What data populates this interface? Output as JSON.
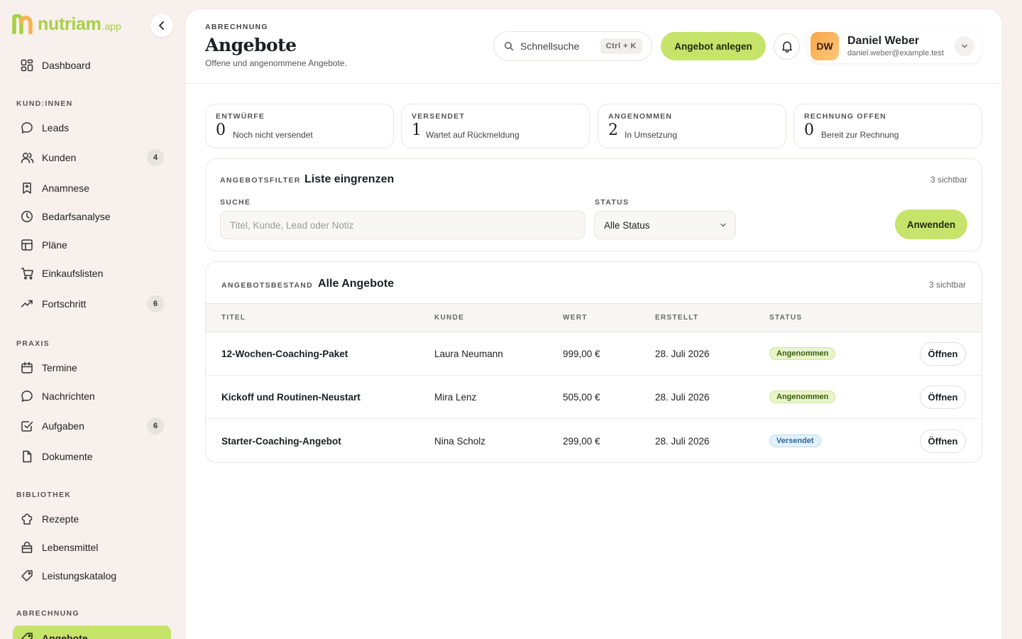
{
  "brand": {
    "name": "nutriam",
    "suffix": ".app"
  },
  "sidebar": {
    "sections": [
      "KUND:INNEN",
      "PRAXIS",
      "BIBLIOTHEK",
      "ABRECHNUNG"
    ],
    "items": [
      {
        "label": "Dashboard"
      },
      {
        "label": "Leads"
      },
      {
        "label": "Kunden",
        "badge": "4"
      },
      {
        "label": "Anamnese"
      },
      {
        "label": "Bedarfsanalyse"
      },
      {
        "label": "Pläne"
      },
      {
        "label": "Einkaufslisten"
      },
      {
        "label": "Fortschritt",
        "badge": "6"
      },
      {
        "label": "Termine"
      },
      {
        "label": "Nachrichten"
      },
      {
        "label": "Aufgaben",
        "badge": "6"
      },
      {
        "label": "Dokumente"
      },
      {
        "label": "Rezepte"
      },
      {
        "label": "Lebensmittel"
      },
      {
        "label": "Leistungskatalog"
      },
      {
        "label": "Angebote",
        "active": true
      }
    ]
  },
  "header": {
    "eyebrow": "ABRECHNUNG",
    "title": "Angebote",
    "subtitle": "Offene und angenommene Angebote.",
    "search_placeholder": "Schnellsuche",
    "shortcut": "Ctrl + K",
    "primary_action": "Angebot anlegen",
    "user": {
      "initials": "DW",
      "name": "Daniel Weber",
      "email": "daniel.weber@example.test"
    }
  },
  "stats": [
    {
      "label": "ENTWÜRFE",
      "value": "0",
      "desc": "Noch nicht versendet"
    },
    {
      "label": "VERSENDET",
      "value": "1",
      "desc": "Wartet auf Rückmeldung"
    },
    {
      "label": "ANGENOMMEN",
      "value": "2",
      "desc": "In Umsetzung"
    },
    {
      "label": "RECHNUNG OFFEN",
      "value": "0",
      "desc": "Bereit zur Rechnung"
    }
  ],
  "filter": {
    "eyebrow": "ANGEBOTSFILTER",
    "title": "Liste eingrenzen",
    "count": "3 sichtbar",
    "search_label": "SUCHE",
    "search_placeholder": "Titel, Kunde, Lead oder Notiz",
    "status_label": "STATUS",
    "status_value": "Alle Status",
    "apply": "Anwenden"
  },
  "offers": {
    "eyebrow": "ANGEBOTSBESTAND",
    "title": "Alle Angebote",
    "count": "3 sichtbar",
    "columns": [
      "TITEL",
      "KUNDE",
      "WERT",
      "ERSTELLT",
      "STATUS"
    ],
    "rows": [
      {
        "title": "12-Wochen-Coaching-Paket",
        "client": "Laura Neumann",
        "value": "999,00 €",
        "created": "28. Juli 2026",
        "status": "Angenommen",
        "action": "Öffnen"
      },
      {
        "title": "Kickoff und Routinen-Neustart",
        "client": "Mira Lenz",
        "value": "505,00 €",
        "created": "28. Juli 2026",
        "status": "Angenommen",
        "action": "Öffnen"
      },
      {
        "title": "Starter-Coaching-Angebot",
        "client": "Nina Scholz",
        "value": "299,00 €",
        "created": "28. Juli 2026",
        "status": "Versendet",
        "action": "Öffnen"
      }
    ]
  },
  "colors": {
    "accent": "#c6e46a",
    "brand": "#a8cf45",
    "sidebar_bg": "#f7f0ec",
    "accepted": "#e7f5c8",
    "sent": "#e3f1fb"
  }
}
